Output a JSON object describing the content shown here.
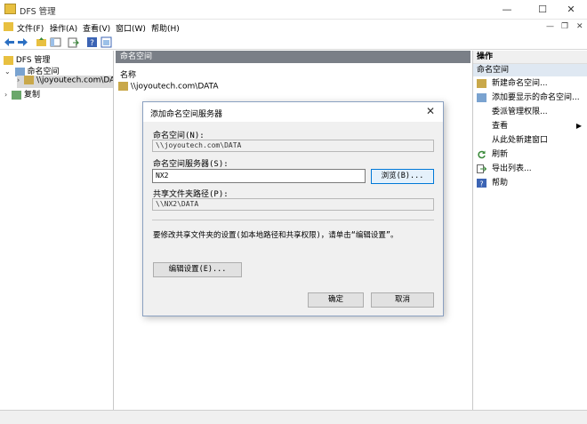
{
  "window": {
    "title": "DFS 管理",
    "minimize": "—",
    "maximize": "☐",
    "close": "✕"
  },
  "menu": {
    "items": [
      "文件(F)",
      "操作(A)",
      "查看(V)",
      "窗口(W)",
      "帮助(H)"
    ]
  },
  "tree": {
    "root": "DFS 管理",
    "namespaces": "命名空间",
    "namespace_item": "\\\\joyoutech.com\\DATA",
    "replication": "复制"
  },
  "center": {
    "header": "命名空间",
    "column_name": "名称",
    "row": "\\\\joyoutech.com\\DATA"
  },
  "actions": {
    "header": "操作",
    "section": "命名空间",
    "items": [
      "新建命名空间...",
      "添加要显示的命名空间...",
      "委派管理权限...",
      "查看",
      "从此处新建窗口",
      "刷新",
      "导出列表...",
      "帮助"
    ]
  },
  "dialog": {
    "title": "添加命名空间服务器",
    "namespace_label": "命名空间(N):",
    "namespace_value": "\\\\joyoutech.com\\DATA",
    "server_label": "命名空间服务器(S):",
    "server_value": "NX2",
    "browse": "浏览(B)...",
    "share_path_label": "共享文件夹路径(P):",
    "share_path_value": "\\\\NX2\\DATA",
    "info": "要修改共享文件夹的设置(如本地路径和共享权限)，请单击“编辑设置”。",
    "edit_settings": "编辑设置(E)...",
    "ok": "确定",
    "cancel": "取消"
  },
  "colors": {
    "pane_header": "#7a7f87",
    "selection": "#dfe8f2",
    "accent": "#0078d7"
  }
}
